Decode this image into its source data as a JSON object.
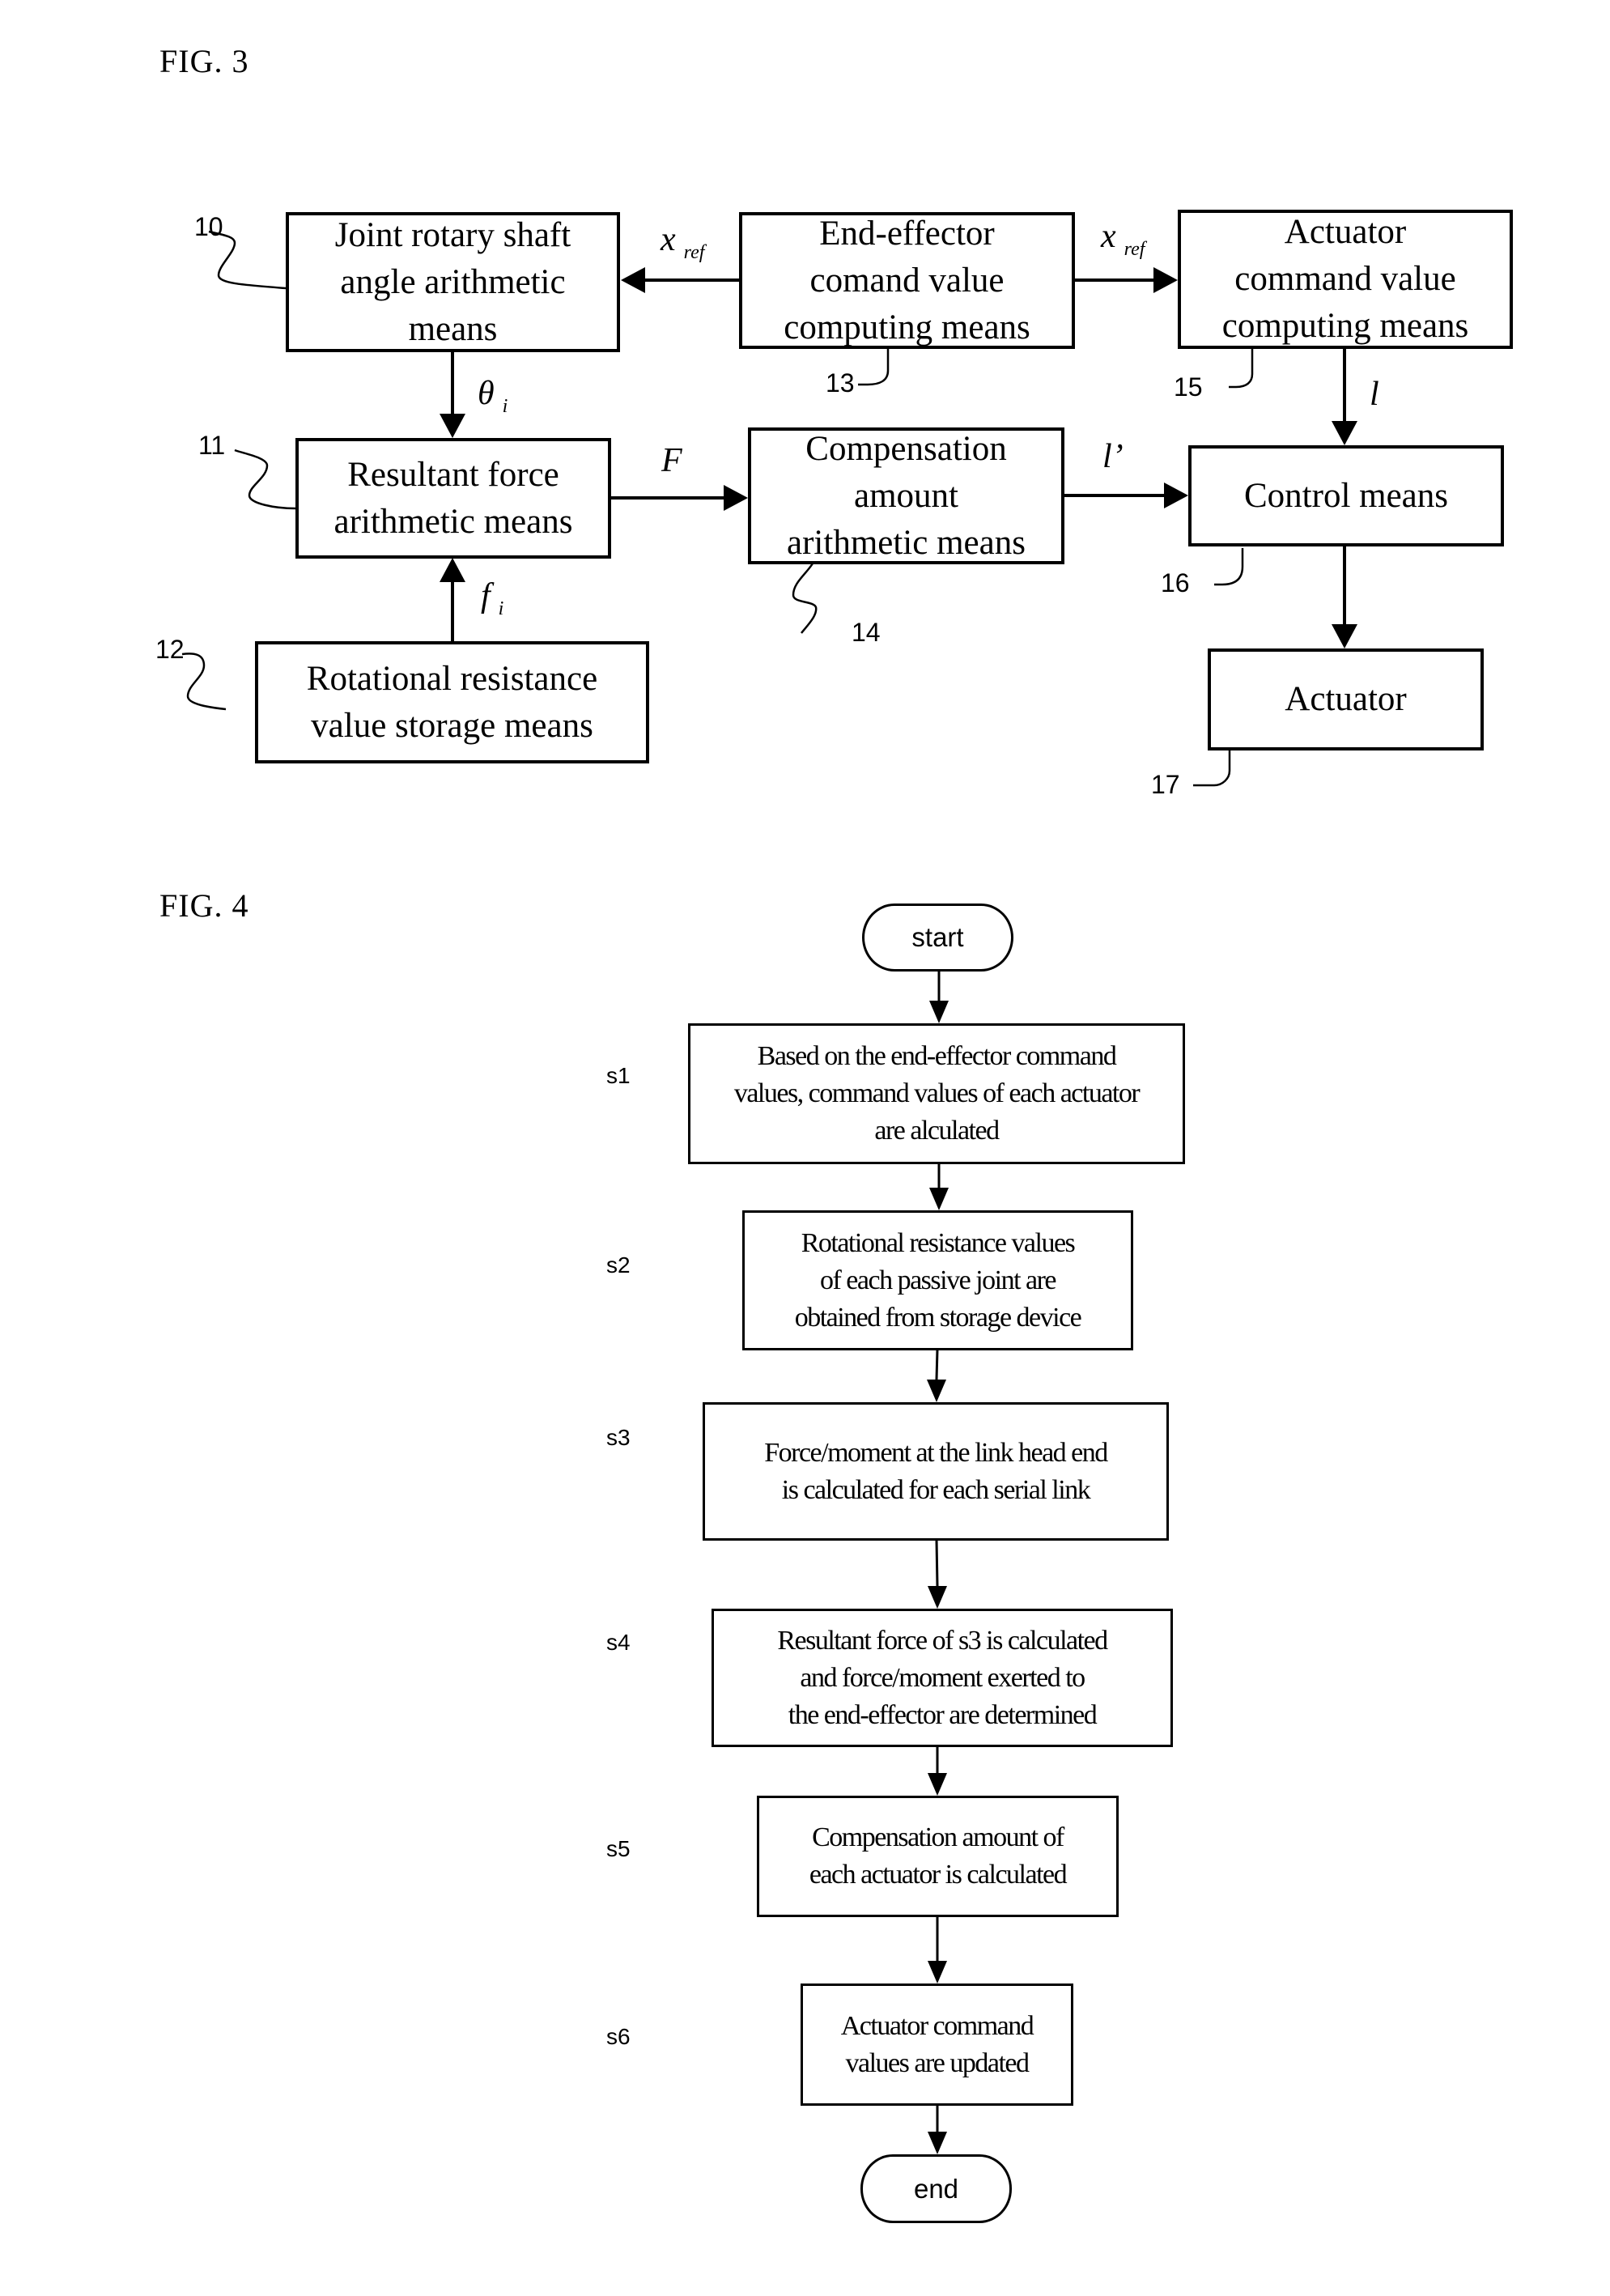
{
  "fig3": {
    "title": "FIG. 3",
    "blocks": {
      "b10": {
        "ref": "10",
        "lines": [
          "Joint rotary shaft",
          "angle arithmetic",
          "means"
        ]
      },
      "b11": {
        "ref": "11",
        "lines": [
          "Resultant force",
          "arithmetic means"
        ]
      },
      "b12": {
        "ref": "12",
        "lines": [
          "Rotational resistance",
          "value storage means"
        ]
      },
      "b13": {
        "ref": "13",
        "lines": [
          "End-effector",
          "comand value",
          "computing means"
        ]
      },
      "b14": {
        "ref": "14",
        "lines": [
          "Compensation",
          "amount",
          "arithmetic means"
        ]
      },
      "b15": {
        "ref": "15",
        "lines": [
          "Actuator",
          "command value",
          "computing means"
        ]
      },
      "b16": {
        "ref": "16",
        "lines": [
          "Control means"
        ]
      },
      "b17": {
        "ref": "17",
        "lines": [
          "Actuator"
        ]
      }
    },
    "signals": {
      "xref_left": {
        "main": "x",
        "sub": "ref"
      },
      "xref_right": {
        "main": "x",
        "sub": "ref"
      },
      "theta": {
        "main": "θ",
        "sub": "i"
      },
      "fi": {
        "main": "f",
        "sub": "i"
      },
      "F": {
        "main": "F",
        "sub": ""
      },
      "l_prime": {
        "main": "l’",
        "sub": ""
      },
      "l": {
        "main": "l",
        "sub": ""
      }
    }
  },
  "fig4": {
    "title": "FIG. 4",
    "start_label": "start",
    "end_label": "end",
    "steps": [
      {
        "id": "s1",
        "lines": [
          "Based on the end-effector command",
          "values, command values of each actuator",
          "are alculated"
        ]
      },
      {
        "id": "s2",
        "lines": [
          "Rotational resistance values",
          "of each passive joint are",
          "obtained from storage device"
        ]
      },
      {
        "id": "s3",
        "lines": [
          "Force/moment at the link head end",
          "is calculated for each serial link"
        ]
      },
      {
        "id": "s4",
        "lines": [
          "Resultant force of s3 is calculated",
          "and force/moment exerted to",
          "the end-effector are determined"
        ]
      },
      {
        "id": "s5",
        "lines": [
          "Compensation amount of",
          "each actuator is calculated"
        ]
      },
      {
        "id": "s6",
        "lines": [
          "Actuator command",
          "values are updated"
        ]
      }
    ]
  }
}
